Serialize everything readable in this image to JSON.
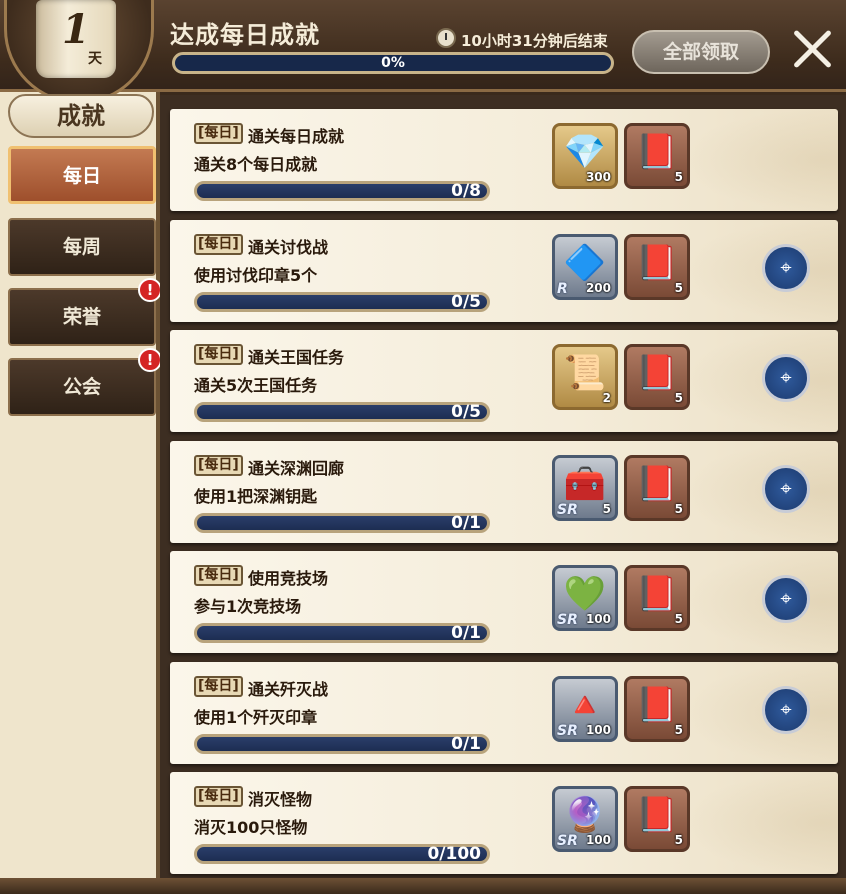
{
  "header": {
    "day_number": "1",
    "day_unit": "天",
    "badge_label": "成就",
    "title": "达成每日成就",
    "timer_text": "10小时31分钟后结束",
    "total_progress_text": "0%",
    "total_progress_value": 0,
    "claim_all_label": "全部领取"
  },
  "sidebar": {
    "tabs": [
      {
        "label": "每日",
        "active": true,
        "alert": ""
      },
      {
        "label": "每周",
        "active": false,
        "alert": ""
      },
      {
        "label": "荣誉",
        "active": false,
        "alert": "!"
      },
      {
        "label": "公会",
        "active": false,
        "alert": "!"
      }
    ]
  },
  "quests": [
    {
      "tag": "[每日]",
      "name": "通关每日成就",
      "desc": "通关8个每日成就",
      "progress": "0/8",
      "reward1": {
        "icon": "diamond-icon",
        "glyph": "💎",
        "count": "300",
        "grade": ""
      },
      "reward2": {
        "icon": "book-icon",
        "glyph": "📕",
        "count": "5"
      },
      "locate": false
    },
    {
      "tag": "[每日]",
      "name": "通关讨伐战",
      "desc": "使用讨伐印章5个",
      "progress": "0/5",
      "reward1": {
        "icon": "crystal-icon",
        "glyph": "🔷",
        "count": "200",
        "grade": "R"
      },
      "reward2": {
        "icon": "book-icon",
        "glyph": "📕",
        "count": "5"
      },
      "locate": true
    },
    {
      "tag": "[每日]",
      "name": "通关王国任务",
      "desc": "通关5次王国任务",
      "progress": "0/5",
      "reward1": {
        "icon": "ticket-icon",
        "glyph": "📜",
        "count": "2",
        "grade": ""
      },
      "reward2": {
        "icon": "book-icon",
        "glyph": "📕",
        "count": "5"
      },
      "locate": true
    },
    {
      "tag": "[每日]",
      "name": "通关深渊回廊",
      "desc": "使用1把深渊钥匙",
      "progress": "0/1",
      "reward1": {
        "icon": "chest-icon",
        "glyph": "🧰",
        "count": "5",
        "grade": "SR"
      },
      "reward2": {
        "icon": "book-icon",
        "glyph": "📕",
        "count": "5"
      },
      "locate": true
    },
    {
      "tag": "[每日]",
      "name": "使用竞技场",
      "desc": "参与1次竞技场",
      "progress": "0/1",
      "reward1": {
        "icon": "green-gem-icon",
        "glyph": "💚",
        "count": "100",
        "grade": "SR"
      },
      "reward2": {
        "icon": "book-icon",
        "glyph": "📕",
        "count": "5"
      },
      "locate": true
    },
    {
      "tag": "[每日]",
      "name": "通关歼灭战",
      "desc": "使用1个歼灭印章",
      "progress": "0/1",
      "reward1": {
        "icon": "pyramid-icon",
        "glyph": "🔺",
        "count": "100",
        "grade": "SR"
      },
      "reward2": {
        "icon": "book-icon",
        "glyph": "📕",
        "count": "5"
      },
      "locate": true
    },
    {
      "tag": "[每日]",
      "name": "消灭怪物",
      "desc": "消灭100只怪物",
      "progress": "0/100",
      "reward1": {
        "icon": "orb-icon",
        "glyph": "🔮",
        "count": "100",
        "grade": "SR"
      },
      "reward2": {
        "icon": "book-icon",
        "glyph": "📕",
        "count": "5"
      },
      "locate": false
    }
  ]
}
